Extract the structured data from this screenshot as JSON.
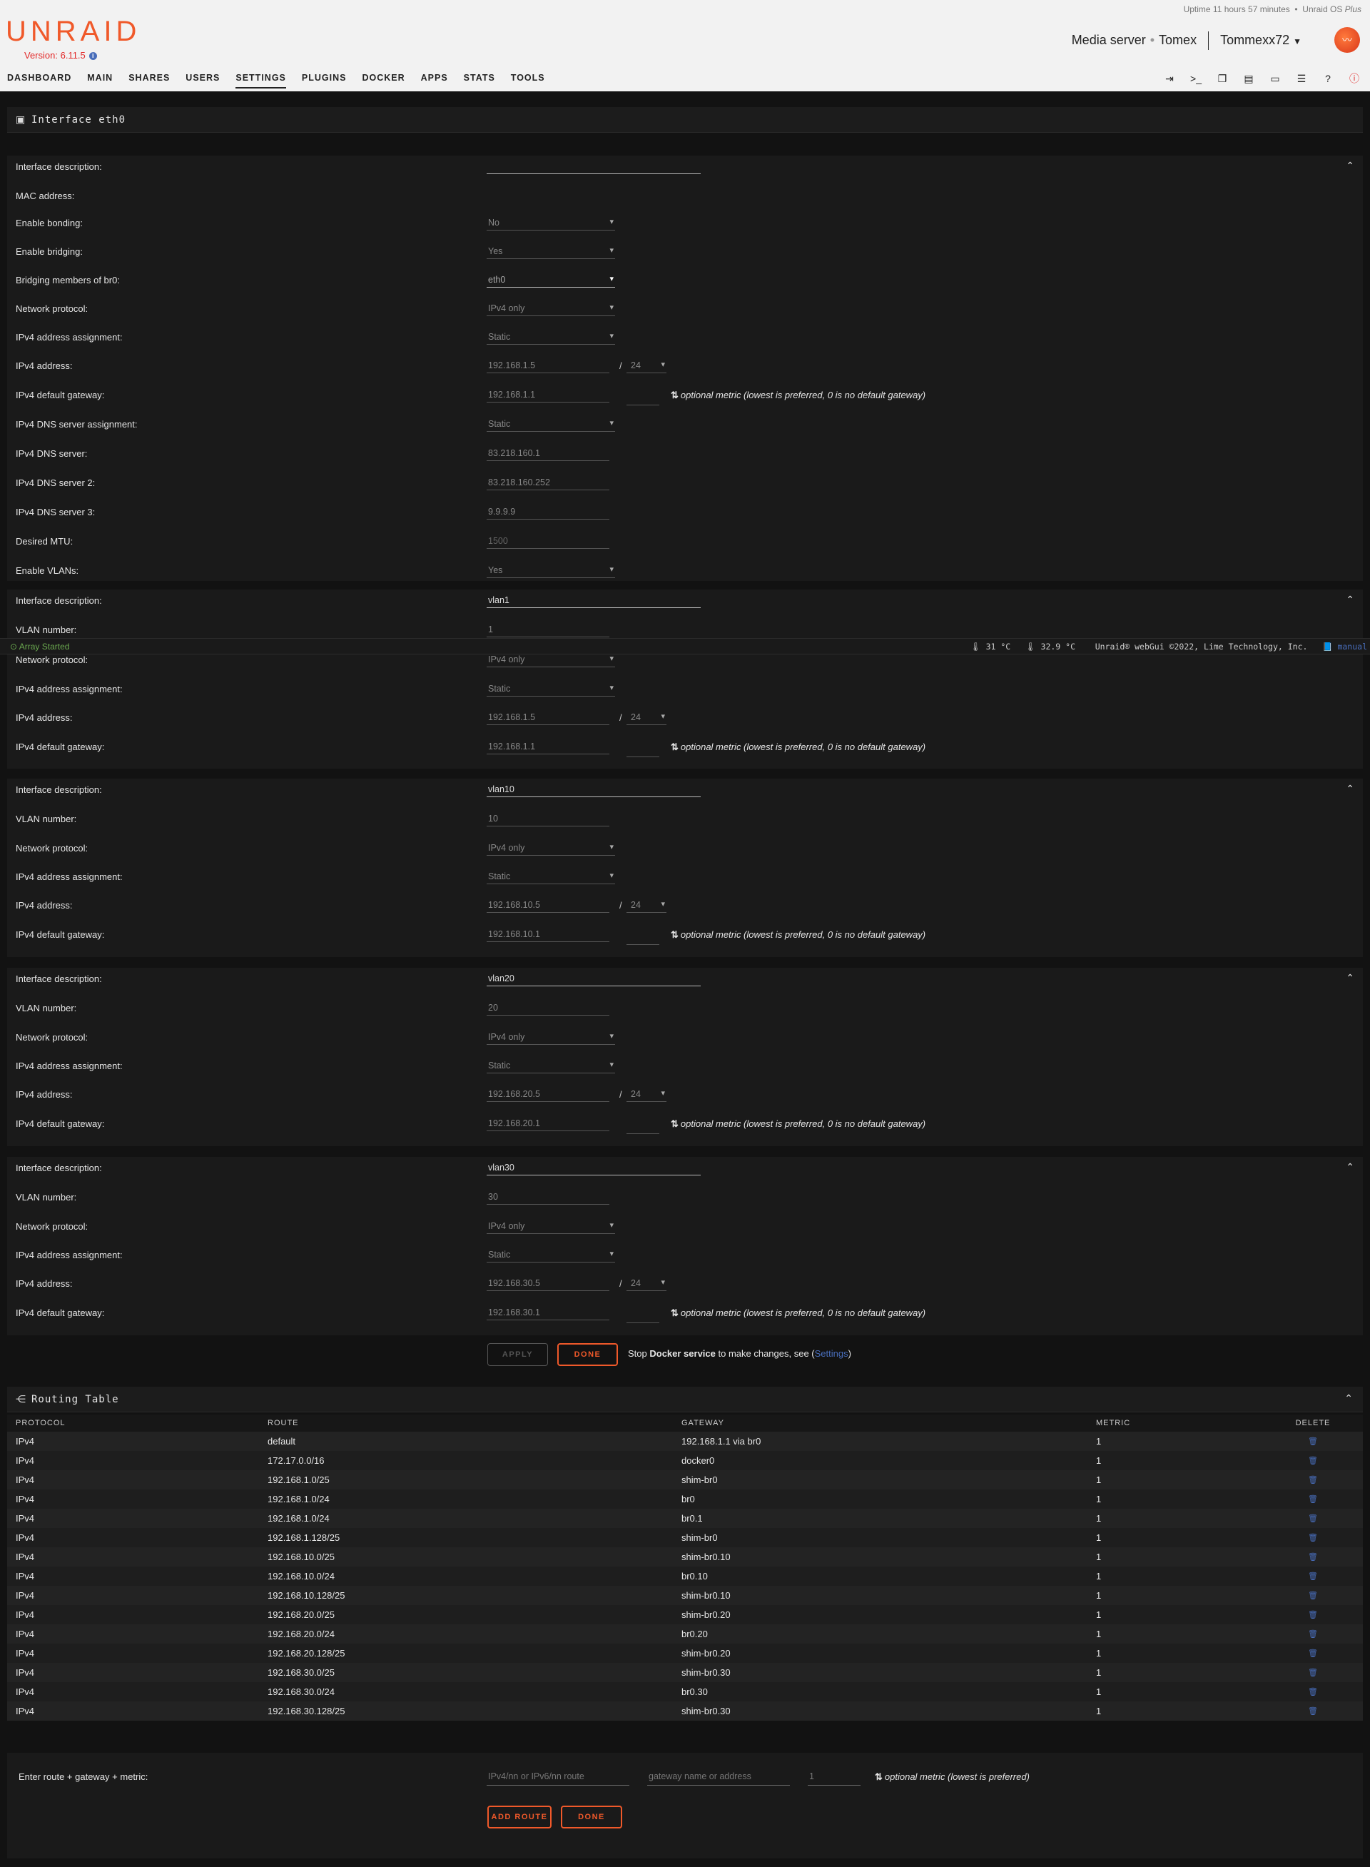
{
  "header": {
    "logo": "UNRAID",
    "version": "Version: 6.11.5",
    "uptime": "Uptime 11 hours 57 minutes",
    "os_prefix": "Unraid OS ",
    "os_plan": "Plus",
    "server_desc": "Media server",
    "server_name": "Tomex",
    "user": "Tommexx72",
    "nav": [
      "DASHBOARD",
      "MAIN",
      "SHARES",
      "USERS",
      "SETTINGS",
      "PLUGINS",
      "DOCKER",
      "APPS",
      "STATS",
      "TOOLS"
    ],
    "active_nav": "SETTINGS"
  },
  "interface": {
    "title": "Interface eth0",
    "fields": {
      "desc_label": "Interface description:",
      "mac_label": "MAC address:",
      "bonding_label": "Enable bonding:",
      "bonding_value": "No",
      "bridging_label": "Enable bridging:",
      "bridging_value": "Yes",
      "members_label": "Bridging members of br0:",
      "members_value": "eth0",
      "protocol_label": "Network protocol:",
      "protocol_value": "IPv4 only",
      "assign_label": "IPv4 address assignment:",
      "assign_value": "Static",
      "ip_label": "IPv4 address:",
      "ip_value": "192.168.1.5",
      "mask_value": "24",
      "gw_label": "IPv4 default gateway:",
      "gw_value": "192.168.1.1",
      "metric_hint": "optional metric (lowest is preferred, 0 is no default gateway)",
      "dns_assign_label": "IPv4 DNS server assignment:",
      "dns_assign_value": "Static",
      "dns1_label": "IPv4 DNS server:",
      "dns1_value": "83.218.160.1",
      "dns2_label": "IPv4 DNS server 2:",
      "dns2_value": "83.218.160.252",
      "dns3_label": "IPv4 DNS server 3:",
      "dns3_value": "9.9.9.9",
      "mtu_label": "Desired MTU:",
      "mtu_value": "1500",
      "vlans_label": "Enable VLANs:",
      "vlans_value": "Yes",
      "vlan_num_label": "VLAN number:"
    },
    "vlans": [
      {
        "desc": "vlan1",
        "number": "1",
        "protocol": "IPv4 only",
        "assign": "Static",
        "ip": "192.168.1.5",
        "mask": "24",
        "gw": "192.168.1.1"
      },
      {
        "desc": "vlan10",
        "number": "10",
        "protocol": "IPv4 only",
        "assign": "Static",
        "ip": "192.168.10.5",
        "mask": "24",
        "gw": "192.168.10.1"
      },
      {
        "desc": "vlan20",
        "number": "20",
        "protocol": "IPv4 only",
        "assign": "Static",
        "ip": "192.168.20.5",
        "mask": "24",
        "gw": "192.168.20.1"
      },
      {
        "desc": "vlan30",
        "number": "30",
        "protocol": "IPv4 only",
        "assign": "Static",
        "ip": "192.168.30.5",
        "mask": "24",
        "gw": "192.168.30.1"
      }
    ],
    "apply_label": "APPLY",
    "done_label": "DONE",
    "note_pre": "Stop ",
    "note_bold": "Docker service",
    "note_mid": " to make changes, see (",
    "note_link": "Settings",
    "note_post": ")"
  },
  "statusbar": {
    "array": "Array Started",
    "temp1": "31 °C",
    "temp2": "32.9 °C",
    "copyright": "Unraid® webGui ©2022, Lime Technology, Inc.",
    "manual": "manual"
  },
  "routing": {
    "title": "Routing Table",
    "columns": [
      "PROTOCOL",
      "ROUTE",
      "GATEWAY",
      "METRIC",
      "DELETE"
    ],
    "rows": [
      [
        "IPv4",
        "default",
        "192.168.1.1 via br0",
        "1"
      ],
      [
        "IPv4",
        "172.17.0.0/16",
        "docker0",
        "1"
      ],
      [
        "IPv4",
        "192.168.1.0/25",
        "shim-br0",
        "1"
      ],
      [
        "IPv4",
        "192.168.1.0/24",
        "br0",
        "1"
      ],
      [
        "IPv4",
        "192.168.1.0/24",
        "br0.1",
        "1"
      ],
      [
        "IPv4",
        "192.168.1.128/25",
        "shim-br0",
        "1"
      ],
      [
        "IPv4",
        "192.168.10.0/25",
        "shim-br0.10",
        "1"
      ],
      [
        "IPv4",
        "192.168.10.0/24",
        "br0.10",
        "1"
      ],
      [
        "IPv4",
        "192.168.10.128/25",
        "shim-br0.10",
        "1"
      ],
      [
        "IPv4",
        "192.168.20.0/25",
        "shim-br0.20",
        "1"
      ],
      [
        "IPv4",
        "192.168.20.0/24",
        "br0.20",
        "1"
      ],
      [
        "IPv4",
        "192.168.20.128/25",
        "shim-br0.20",
        "1"
      ],
      [
        "IPv4",
        "192.168.30.0/25",
        "shim-br0.30",
        "1"
      ],
      [
        "IPv4",
        "192.168.30.0/24",
        "br0.30",
        "1"
      ],
      [
        "IPv4",
        "192.168.30.128/25",
        "shim-br0.30",
        "1"
      ]
    ],
    "add_label": "Enter route + gateway + metric:",
    "route_placeholder": "IPv4/nn or IPv6/nn route",
    "gateway_placeholder": "gateway name or address",
    "metric_value": "1",
    "metric_hint": "optional metric (lowest is preferred)",
    "add_button": "ADD ROUTE",
    "done_button": "DONE"
  }
}
